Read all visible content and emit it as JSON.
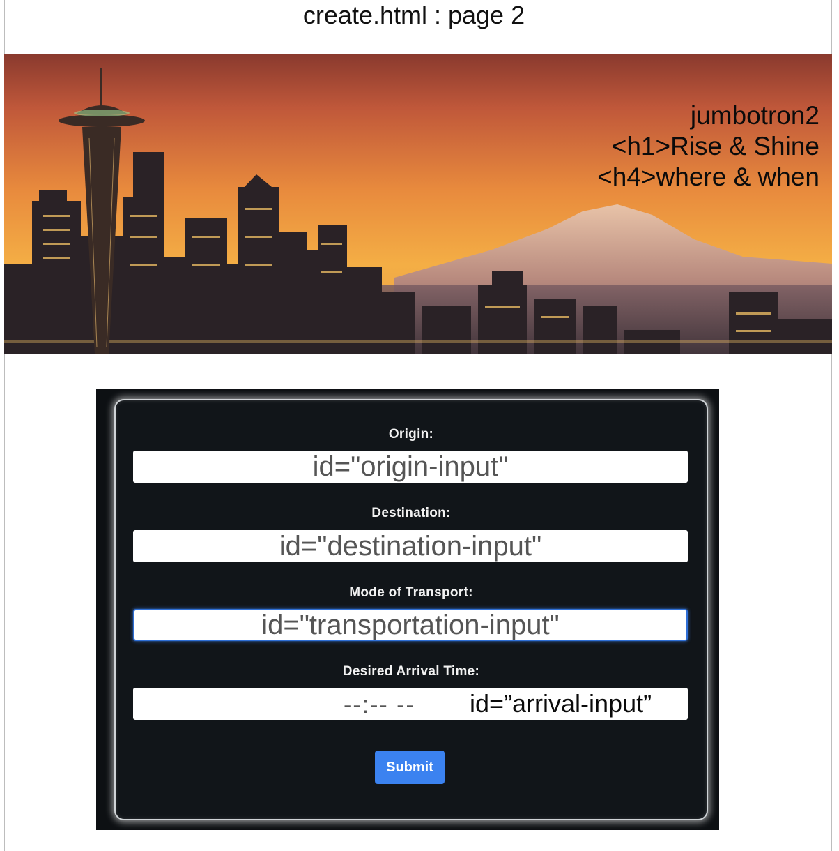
{
  "page": {
    "title": "create.html : page 2"
  },
  "jumbotron": {
    "id_label": "jumbotron2",
    "heading": "<h1>Rise & Shine",
    "subheading": "<h4>where & when"
  },
  "form": {
    "origin": {
      "label": "Origin:",
      "value": "id=\"origin-input\""
    },
    "destination": {
      "label": "Destination:",
      "value": "id=\"destination-input\""
    },
    "transport": {
      "label": "Mode of Transport:",
      "value": "id=\"transportation-input\""
    },
    "arrival": {
      "label": "Desired Arrival Time:",
      "placeholder": "--:-- --",
      "note": "id=”arrival-input”"
    },
    "submit_label": "Submit"
  },
  "colors": {
    "accent": "#3b82f0",
    "panel_bg": "#111519",
    "sky_top": "#8a3a2e",
    "sky_horizon": "#f1a83c"
  }
}
